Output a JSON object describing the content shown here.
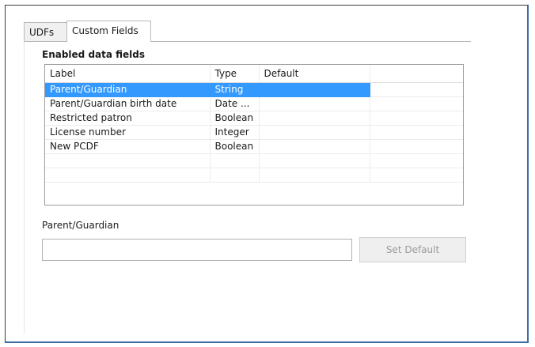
{
  "tabs": [
    {
      "label": "UDFs",
      "active": false
    },
    {
      "label": "Custom Fields",
      "active": true
    }
  ],
  "section": {
    "title": "Enabled data fields"
  },
  "grid": {
    "columns": [
      "Label",
      "Type",
      "Default"
    ],
    "rows": [
      {
        "label": "Parent/Guardian",
        "type": "String",
        "default": "",
        "selected": true
      },
      {
        "label": "Parent/Guardian birth date",
        "type": "Date ...",
        "default": "",
        "selected": false
      },
      {
        "label": "Restricted patron",
        "type": "Boolean",
        "default": "",
        "selected": false
      },
      {
        "label": "License number",
        "type": "Integer",
        "default": "",
        "selected": false
      },
      {
        "label": "New PCDF",
        "type": "Boolean",
        "default": "",
        "selected": false
      }
    ]
  },
  "default_editor": {
    "label": "Parent/Guardian",
    "value": "",
    "button_label": "Set Default",
    "button_enabled": false
  },
  "colors": {
    "selection": "#3399ff",
    "frame_accent": "#3a6ea5"
  }
}
